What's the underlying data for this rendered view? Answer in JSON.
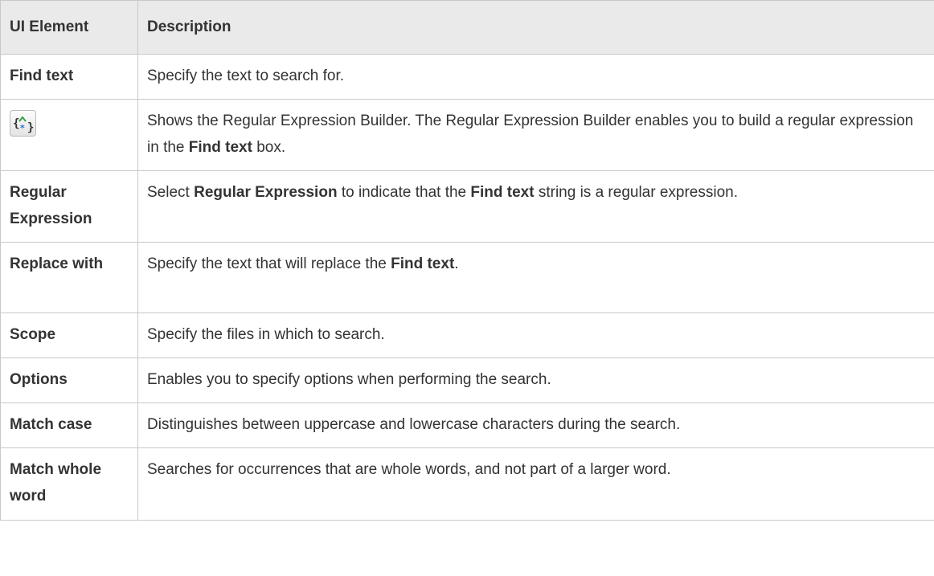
{
  "table": {
    "headers": {
      "element": "UI Element",
      "description": "Description"
    },
    "rows": {
      "find_text": {
        "element": "Find text",
        "description": "Specify the text to search for."
      },
      "regex_builder": {
        "element_icon": "regex-builder-icon",
        "description_part1": "Shows the Regular Expression Builder. The Regular Expression Builder enables you to build a regular expression in the ",
        "description_bold1": "Find text",
        "description_part2": " box."
      },
      "regular_expression": {
        "element": "Regular Expression",
        "description_part1": "Select ",
        "description_bold1": "Regular Expression",
        "description_part2": " to indicate that the ",
        "description_bold2": "Find text",
        "description_part3": " string is a regular expression."
      },
      "replace_with": {
        "element": "Replace with",
        "description_part1": "Specify the text that will replace the ",
        "description_bold1": "Find text",
        "description_part2": "."
      },
      "scope": {
        "element": "Scope",
        "description": "Specify the files in which to search."
      },
      "options": {
        "element": "Options",
        "description": "Enables you to specify options when performing the search."
      },
      "match_case": {
        "element": "Match case",
        "description": "Distinguishes between uppercase and lowercase characters during the search."
      },
      "match_whole_word": {
        "element": "Match whole word",
        "description": "Searches for occurrences that are whole words, and not part of a larger word."
      }
    }
  }
}
